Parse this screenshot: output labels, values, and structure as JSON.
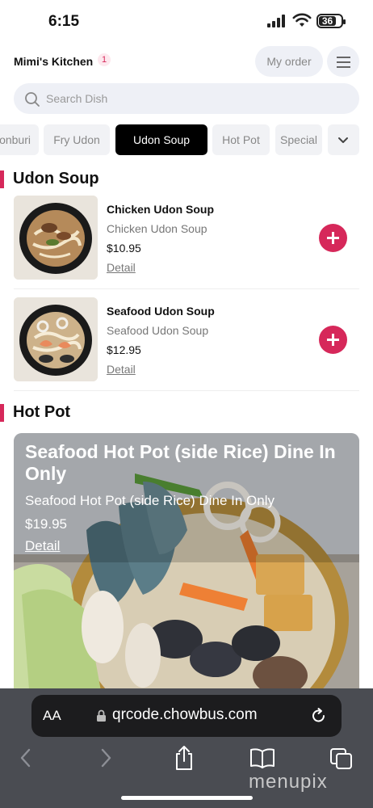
{
  "status_bar": {
    "time": "6:15",
    "battery": "36"
  },
  "header": {
    "store_name": "Mimi's Kitchen",
    "cart_count": "1",
    "my_order_label": "My order"
  },
  "search": {
    "placeholder": "Search Dish"
  },
  "categories": [
    {
      "label": "Donburi",
      "visible": "onburi"
    },
    {
      "label": "Fry Udon"
    },
    {
      "label": "Udon Soup",
      "active": true
    },
    {
      "label": "Hot Pot"
    },
    {
      "label": "Special"
    }
  ],
  "sections": [
    {
      "title": "Udon Soup",
      "items": [
        {
          "name": "Chicken Udon Soup",
          "description": "Chicken Udon Soup",
          "price": "$10.95",
          "detail_label": "Detail"
        },
        {
          "name": "Seafood Udon Soup",
          "description": "Seafood Udon Soup",
          "price": "$12.95",
          "detail_label": "Detail"
        }
      ]
    },
    {
      "title": "Hot Pot",
      "featured": {
        "name": "Seafood Hot Pot (side Rice) Dine In Only",
        "description": "Seafood Hot Pot (side Rice) Dine In Only",
        "price": "$19.95",
        "detail_label": "Detail"
      }
    }
  ],
  "browser": {
    "text_size_label": "AA",
    "url": "qrcode.chowbus.com"
  },
  "watermark": "menupix",
  "colors": {
    "accent": "#d6285a",
    "tab_active": "#000000",
    "chip_bg": "#f1f2f5",
    "browser_bar": "#4a4c52"
  }
}
